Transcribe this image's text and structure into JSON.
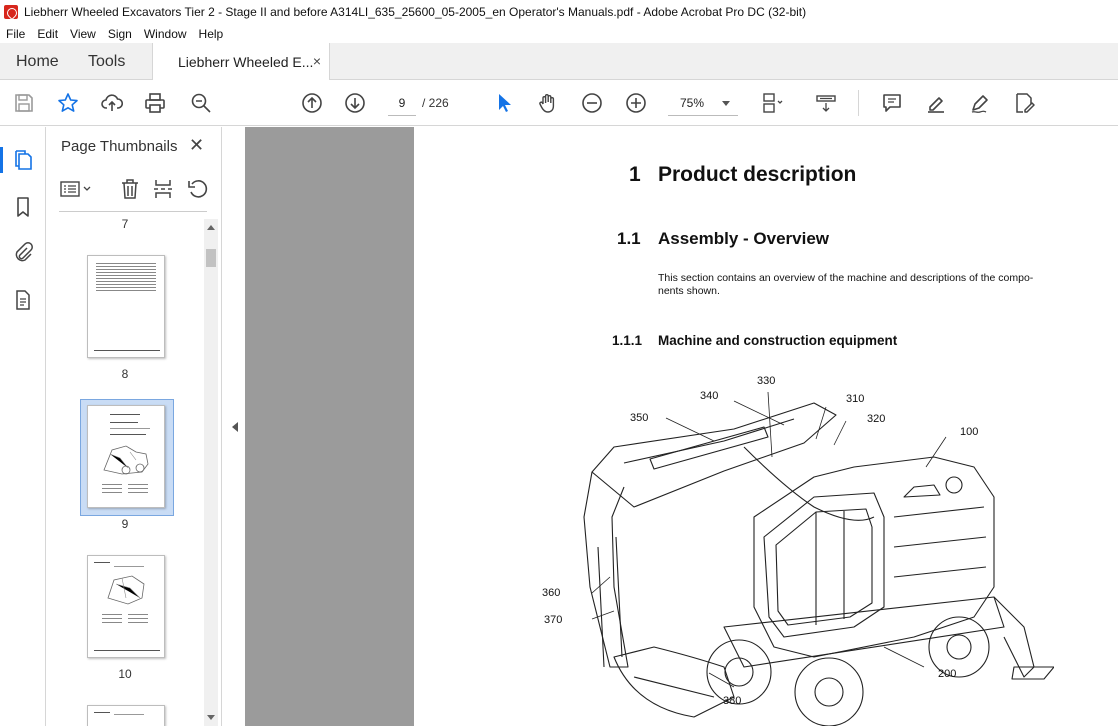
{
  "window": {
    "title": "Liebherr Wheeled Excavators Tier 2 - Stage II and before A314LI_635_25600_05-2005_en Operator's Manuals.pdf - Adobe Acrobat Pro DC (32-bit)"
  },
  "menu": [
    "File",
    "Edit",
    "View",
    "Sign",
    "Window",
    "Help"
  ],
  "tabs": {
    "home": "Home",
    "tools": "Tools",
    "document": "Liebherr Wheeled E...",
    "close": "×"
  },
  "toolbar": {
    "current_page": "9",
    "page_total": "/ 226",
    "zoom": "75%"
  },
  "thumbnails_panel": {
    "title": "Page Thumbnails",
    "close": "✕",
    "pages": [
      "7",
      "8",
      "9",
      "10"
    ],
    "selected_page": "9"
  },
  "document": {
    "h1_num": "1",
    "h1_text": "Product description",
    "h2_num": "1.1",
    "h2_text": "Assembly - Overview",
    "body": "This section contains an overview of the machine and descriptions of the compo-nents shown.",
    "h3_num": "1.1.1",
    "h3_text": "Machine and construction equipment",
    "callouts": [
      "330",
      "340",
      "310",
      "350",
      "320",
      "100",
      "360",
      "370",
      "200",
      "380"
    ]
  },
  "colors": {
    "accent": "#1473e6",
    "doc_background": "#9b9b9b",
    "selection": "#c9dcf5"
  }
}
